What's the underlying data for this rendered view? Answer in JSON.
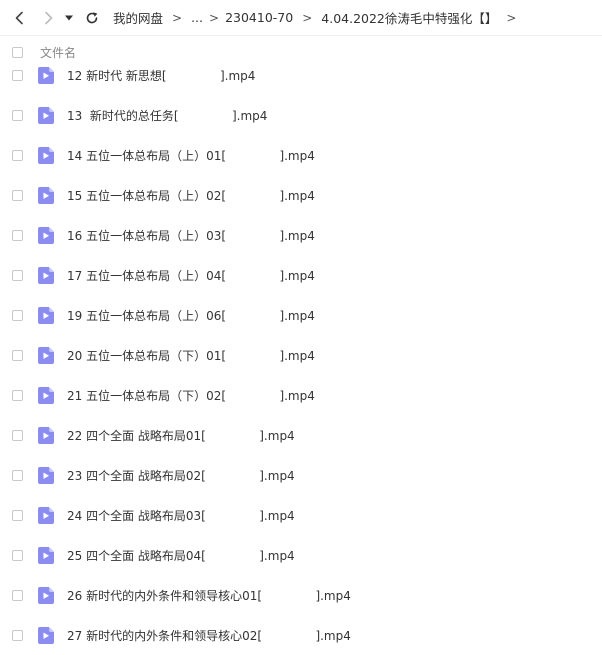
{
  "toolbar": {
    "back_icon": "chevron-left-icon",
    "forward_icon": "chevron-right-icon",
    "dropdown_icon": "caret-down-icon",
    "refresh_icon": "refresh-icon",
    "breadcrumb": [
      "我的网盘",
      "...",
      "230410-70",
      "4.04.2022徐涛毛中特强化【】"
    ],
    "separator": ">"
  },
  "list_header": {
    "name_label": "文件名"
  },
  "files": [
    {
      "name": "12 新时代 新思想[              ].mp4",
      "icon": "video-file-icon"
    },
    {
      "name": "13  新时代的总任务[              ].mp4",
      "icon": "video-file-icon"
    },
    {
      "name": "14 五位一体总布局（上）01[              ].mp4",
      "icon": "video-file-icon"
    },
    {
      "name": "15 五位一体总布局（上）02[              ].mp4",
      "icon": "video-file-icon"
    },
    {
      "name": "16 五位一体总布局（上）03[              ].mp4",
      "icon": "video-file-icon"
    },
    {
      "name": "17 五位一体总布局（上）04[              ].mp4",
      "icon": "video-file-icon"
    },
    {
      "name": "19 五位一体总布局（上）06[              ].mp4",
      "icon": "video-file-icon"
    },
    {
      "name": "20 五位一体总布局（下）01[              ].mp4",
      "icon": "video-file-icon"
    },
    {
      "name": "21 五位一体总布局（下）02[              ].mp4",
      "icon": "video-file-icon"
    },
    {
      "name": "22 四个全面 战略布局01[              ].mp4",
      "icon": "video-file-icon"
    },
    {
      "name": "23 四个全面 战略布局02[              ].mp4",
      "icon": "video-file-icon"
    },
    {
      "name": "24 四个全面 战略布局03[              ].mp4",
      "icon": "video-file-icon"
    },
    {
      "name": "25 四个全面 战略布局04[              ].mp4",
      "icon": "video-file-icon"
    },
    {
      "name": "26 新时代的内外条件和领导核心01[              ].mp4",
      "icon": "video-file-icon"
    },
    {
      "name": "27 新时代的内外条件和领导核心02[              ].mp4",
      "icon": "video-file-icon"
    }
  ],
  "colors": {
    "icon_accent": "#8a8cf0",
    "text": "#333333",
    "muted": "#888888"
  }
}
